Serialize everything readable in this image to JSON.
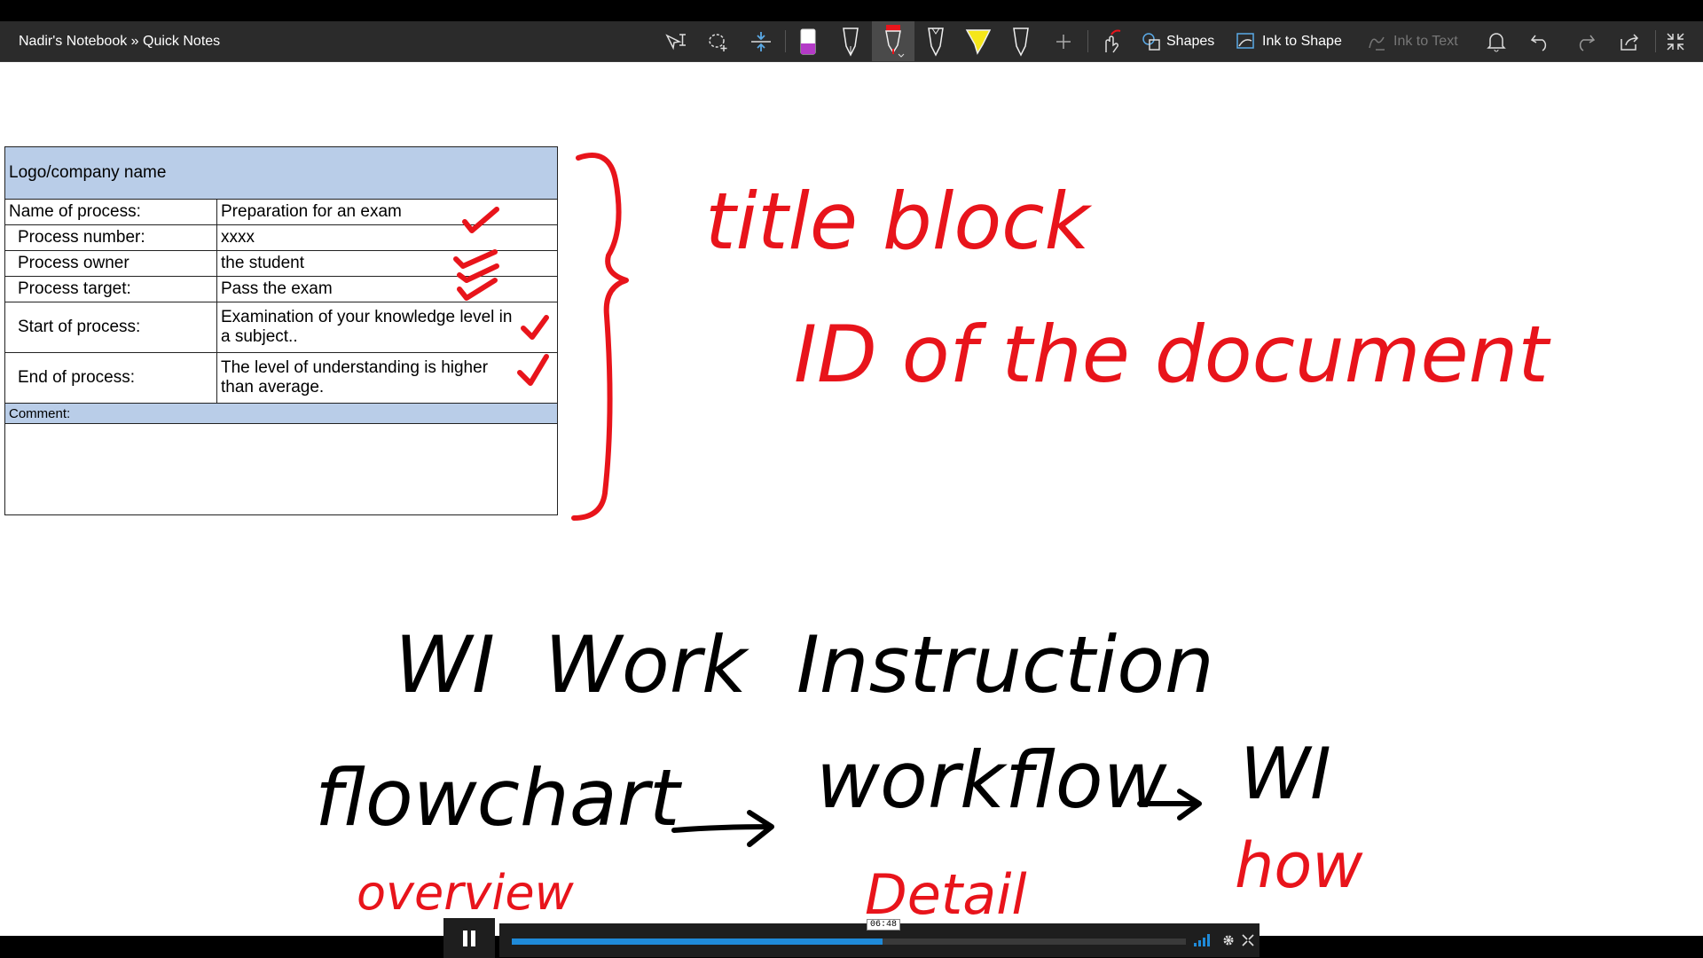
{
  "breadcrumb": "Nadir's Notebook » Quick Notes",
  "toolbar": {
    "shapes_label": "Shapes",
    "ink_to_shape_label": "Ink to Shape",
    "ink_to_text_label": "Ink to Text"
  },
  "title_block": {
    "header": "Logo/company name",
    "rows": [
      {
        "label": "Name of process:",
        "value": "Preparation for an exam"
      },
      {
        "label": "Process number:",
        "value": "xxxx"
      },
      {
        "label": "Process owner",
        "value": "the student"
      },
      {
        "label": "Process target:",
        "value": "Pass the exam"
      },
      {
        "label": "Start of process:",
        "value": "Examination of your knowledge level in a subject.."
      },
      {
        "label": "End of process:",
        "value": "The level of understanding  is higher than average."
      }
    ],
    "comment_label": "Comment:"
  },
  "ink": {
    "title_block": "title block",
    "id_doc": "ID of the document",
    "wi_line": "WI  Work  Instruction",
    "flowchart": "flowchart",
    "workflow": "workflow",
    "wi": "WI",
    "overview": "overview",
    "detail": "Detail",
    "how": "how"
  },
  "player": {
    "time": "06:48",
    "progress": 0.55
  },
  "colors": {
    "ink_red": "#e8141b",
    "ink_black": "#000000",
    "table_header": "#b9cde8",
    "progress": "#1f8ad8"
  }
}
